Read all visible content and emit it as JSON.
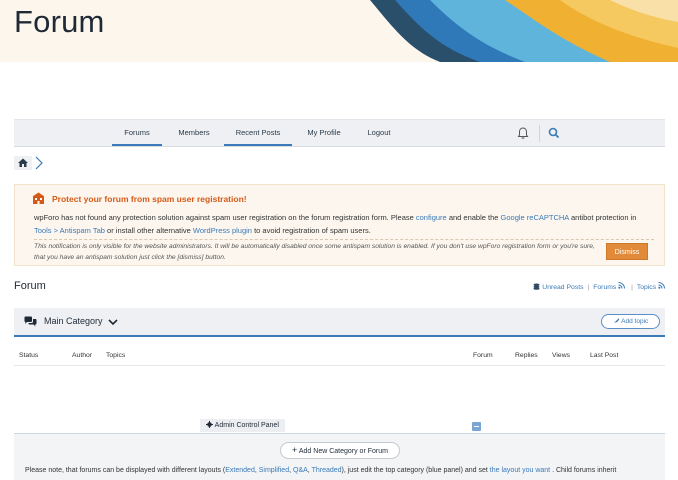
{
  "header": {
    "title": "Forum"
  },
  "nav": {
    "items": [
      {
        "label": "Forums",
        "active": true
      },
      {
        "label": "Members",
        "active": false
      },
      {
        "label": "Recent Posts",
        "active": true
      },
      {
        "label": "My Profile",
        "active": false
      },
      {
        "label": "Logout",
        "active": false
      }
    ],
    "icons": [
      "bell-icon",
      "search-icon"
    ]
  },
  "breadcrumb": {
    "icons": [
      "home-icon",
      "chevron-right-icon"
    ]
  },
  "notice": {
    "title": "Protect your forum from spam user registration!",
    "body_1": "wpForo has not found any protection solution against spam user registration on the forum registration form. Please ",
    "link_configure": "configure",
    "body_2": " and enable the ",
    "link_recaptcha": "Google reCAPTCHA",
    "body_3": " antibot protection in ",
    "link_tools": "Tools > Antispam Tab",
    "body_4": " or install other alternative ",
    "link_plugin": "WordPress plugin",
    "body_5": " to avoid registration of spam users.",
    "note": "This notification is only visible for the website administrators. It will be automatically disabled once some antispam solution is enabled. If you don't use wpForo registration form or you're sure, that you have an antispam solution just click the [dismiss] button.",
    "dismiss_label": "Dismiss",
    "accent": "#d55a17"
  },
  "forum": {
    "heading": "Forum",
    "links": {
      "unread": "Unread Posts",
      "forums": "Forums",
      "topics": "Topics"
    }
  },
  "category": {
    "title": "Main Category",
    "add_topic": "Add topic"
  },
  "columns": {
    "status": "Status",
    "author": "Author",
    "topics": "Topics",
    "forum": "Forum",
    "replies": "Replies",
    "views": "Views",
    "last_post": "Last Post"
  },
  "admin": {
    "panel_label": "Admin Control Panel",
    "add_new": "Add New Category or Forum",
    "note_1": "Please note, that forums can be displayed with different layouts (",
    "layout_extended": "Extended",
    "note_sep1": ", ",
    "layout_simplified": "Simplified",
    "note_sep2": ", ",
    "layout_qa": "Q&A",
    "note_sep3": ", ",
    "layout_threaded": "Threaded",
    "note_2": "), just edit the top category (blue panel) and set ",
    "link_layout": "the layout you want",
    "note_3": " . Child forums inherit"
  },
  "colors": {
    "accent_blue": "#3a7ab8",
    "dismiss": "#e08a3a"
  }
}
